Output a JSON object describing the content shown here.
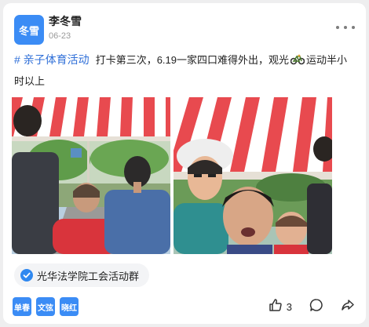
{
  "post": {
    "author_avatar_text": "冬雪",
    "author_name": "李冬雪",
    "date": "06-23",
    "hashtag": "# 亲子体育活动",
    "text_before_icon": "打卡第三次，6.19一家四口难得外出，观光",
    "text_after_icon": "运动半小时以上",
    "icon_inline": "bicycle-emoji-icon"
  },
  "photos": [
    {
      "name": "photo-kids-on-cart",
      "subject": "sightseeing cart ride, two kids and adult facing forward"
    },
    {
      "name": "photo-family-selfie",
      "subject": "family selfie under striped awning"
    }
  ],
  "group": {
    "label": "光华法学院工会活动群",
    "icon": "verified-check-icon"
  },
  "likers": [
    "单春",
    "文弦",
    "晓红"
  ],
  "actions": {
    "like_count": "3",
    "like_icon": "thumbs-up-icon",
    "comment_icon": "comment-bubble-icon",
    "share_icon": "share-arrow-icon"
  },
  "colors": {
    "accent": "#3b8cf5",
    "hashtag": "#2f6fd8",
    "awning_red": "#e84a4f"
  }
}
